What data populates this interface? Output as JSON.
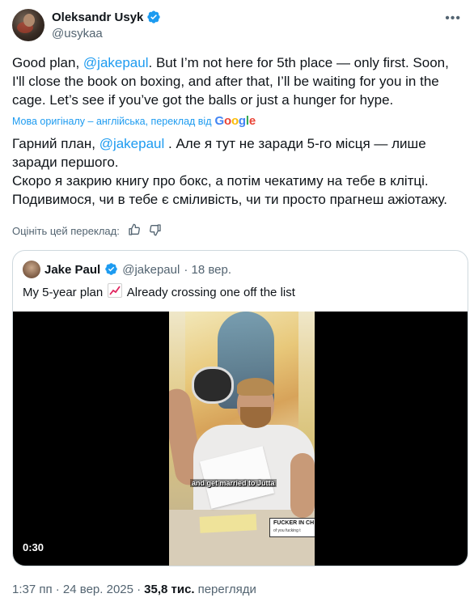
{
  "author": {
    "name": "Oleksandr Usyk",
    "handle": "@usykaa"
  },
  "tweet": {
    "text_parts": {
      "before_mention": "Good plan, ",
      "mention": "@jakepaul",
      "after_mention": ". But I’m not here for 5th place — only first. Soon, I'll close the book on boxing, and after that, I’ll be waiting for you in the cage. Let’s see if you’ve got the balls or just a hunger for hype."
    },
    "translation_note": "Мова оригіналу – англійська, переклад від",
    "google_logo": [
      "G",
      "o",
      "o",
      "g",
      "l",
      "e"
    ],
    "translated_parts": {
      "before_mention": "Гарний план, ",
      "mention": "@jakepaul",
      "line1_rest": " . Але я тут не заради 5-го місця — лише заради першого.",
      "line2": "Скоро я закрию книгу про бокс, а потім чекатиму на тебе в клітці.",
      "line3": "Подивимося, чи в тебе є сміливість, чи ти просто прагнеш ажіотажу."
    },
    "rate_label": "Оцініть цей переклад:"
  },
  "quote": {
    "name": "Jake Paul",
    "handle": "@jakepaul",
    "time": "· 18 вер.",
    "text_before": "My 5-year plan",
    "text_after": "Already crossing one off the list",
    "video": {
      "caption": "and get married to Jutta",
      "sign_text": "FUCKER IN CH",
      "sign_sub": "of you fucking t",
      "duration": "0:30"
    }
  },
  "meta": {
    "datetime": "1:37 пп · 24 вер. 2025 ·",
    "views_count": "35,8 тис.",
    "views_label": "перегляди"
  },
  "colors": {
    "accent": "#1d9bf0",
    "text": "#0f1419",
    "muted": "#536471",
    "border": "#cfd9de"
  }
}
